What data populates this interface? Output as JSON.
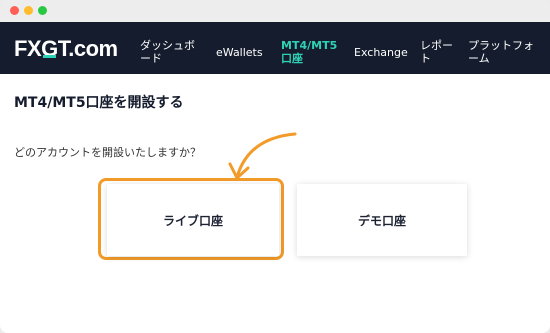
{
  "window": {
    "controls": [
      "close",
      "minimize",
      "maximize"
    ]
  },
  "nav": {
    "logo": {
      "part1": "FX",
      "part2": "G",
      "part3": "T",
      "part4": ".com"
    },
    "items": [
      {
        "label": "ダッシュボード"
      },
      {
        "label": "eWallets"
      },
      {
        "label": "MT4/MT5口座",
        "active": true
      },
      {
        "label": "Exchange"
      },
      {
        "label": "レポート"
      },
      {
        "label": "プラットフォーム"
      }
    ]
  },
  "main": {
    "title": "MT4/MT5口座を開設する",
    "question": "どのアカウントを開設いたしますか？",
    "options": [
      {
        "label": "ライブ口座",
        "highlighted": true
      },
      {
        "label": "デモ口座"
      }
    ]
  },
  "colors": {
    "accent": "#2ed3b7",
    "highlight": "#f29b29",
    "nav_bg": "#151c2d"
  }
}
